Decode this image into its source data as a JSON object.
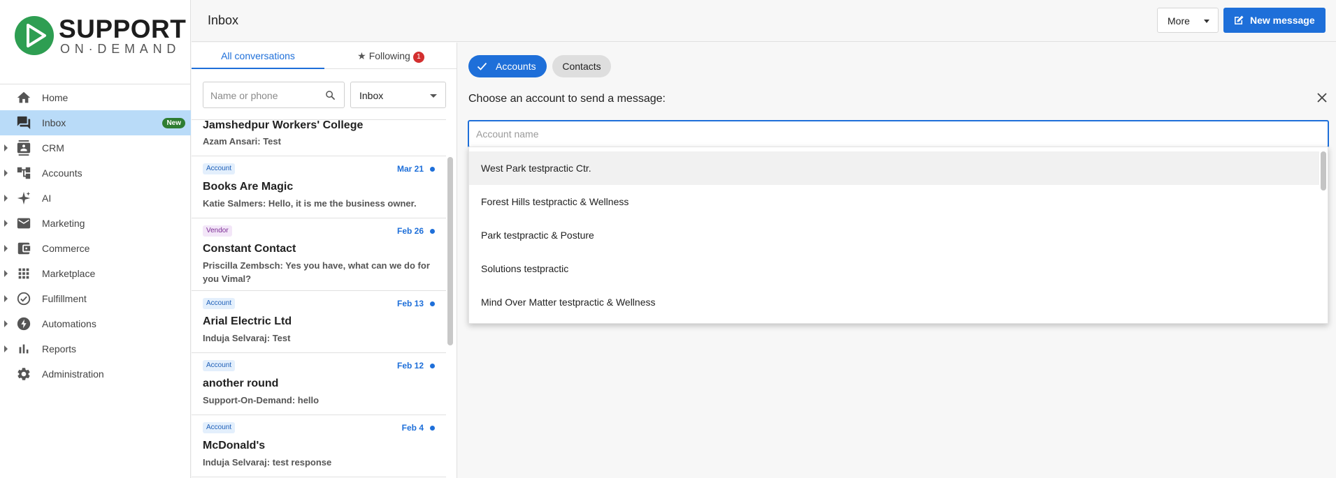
{
  "brand": {
    "top": "SUPPORT",
    "bottom": "ON·DEMAND",
    "green": "#2e9e52"
  },
  "colors": {
    "accent": "#1e6fd9",
    "active_nav": "#b9dbf8",
    "badge_green": "#2e7d32",
    "unread": "#d32f2f"
  },
  "nav": {
    "items": [
      {
        "label": "Home",
        "icon": "home-icon"
      },
      {
        "label": "Inbox",
        "icon": "chat-icon",
        "badge": "New"
      },
      {
        "label": "CRM",
        "icon": "contact-card-icon"
      },
      {
        "label": "Accounts",
        "icon": "hierarchy-icon"
      },
      {
        "label": "AI",
        "icon": "sparkle-icon"
      },
      {
        "label": "Marketing",
        "icon": "mail-icon"
      },
      {
        "label": "Commerce",
        "icon": "wallet-icon"
      },
      {
        "label": "Marketplace",
        "icon": "grid-icon"
      },
      {
        "label": "Fulfillment",
        "icon": "check-circle-icon"
      },
      {
        "label": "Automations",
        "icon": "bolt-icon"
      },
      {
        "label": "Reports",
        "icon": "bar-chart-icon"
      },
      {
        "label": "Administration",
        "icon": "gear-icon"
      }
    ]
  },
  "header": {
    "title": "Inbox",
    "more_label": "More",
    "new_message_label": "New message"
  },
  "conversations": {
    "tabs": {
      "all": "All conversations",
      "following": "Following",
      "following_count": "1"
    },
    "search_placeholder": "Name or phone",
    "filter_value": "Inbox",
    "items": [
      {
        "tag": "",
        "date": "",
        "name": "Jamshedpur Workers' College",
        "message": "Azam Ansari: Test"
      },
      {
        "tag": "Account",
        "date": "Mar 21",
        "name": "Books Are Magic",
        "message": "Katie Salmers: Hello, it is me the business owner."
      },
      {
        "tag": "Vendor",
        "date": "Feb 26",
        "name": "Constant Contact",
        "message": "Priscilla Zembsch: Yes you have, what can we do for you Vimal?"
      },
      {
        "tag": "Account",
        "date": "Feb 13",
        "name": "Arial Electric Ltd",
        "message": "Induja Selvaraj: Test"
      },
      {
        "tag": "Account",
        "date": "Feb 12",
        "name": "another round",
        "message": "Support-On-Demand: hello"
      },
      {
        "tag": "Account",
        "date": "Feb 4",
        "name": "McDonald's",
        "message": "Induja Selvaraj: test response"
      }
    ]
  },
  "compose": {
    "chip_accounts": "Accounts",
    "chip_contacts": "Contacts",
    "prompt": "Choose an account to send a message:",
    "account_placeholder": "Account name",
    "options": [
      "West Park testpractic Ctr.",
      "Forest Hills testpractic & Wellness",
      "Park testpractic & Posture",
      "Solutions testpractic",
      "Mind Over Matter testpractic & Wellness"
    ]
  }
}
